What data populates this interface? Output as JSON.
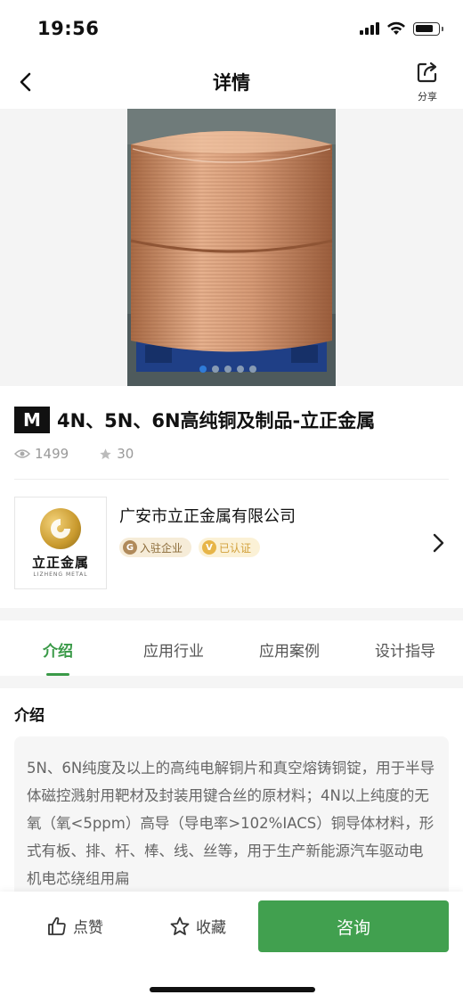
{
  "status_bar": {
    "time": "19:56"
  },
  "nav": {
    "title": "详情",
    "share_label": "分享"
  },
  "carousel": {
    "total_slides": 5,
    "active_index": 0
  },
  "product": {
    "brand_badge": "M",
    "title": "4N、5N、6N高纯铜及制品-立正金属",
    "views": "1499",
    "favorites": "30"
  },
  "company": {
    "name": "广安市立正金属有限公司",
    "logo_cn": "立正金属",
    "logo_en": "LIZHENG METAL",
    "badge_settled": "入驻企业",
    "badge_settled_icon": "G",
    "badge_verified": "已认证",
    "badge_verified_icon": "V"
  },
  "tabs": [
    {
      "label": "介绍",
      "active": true
    },
    {
      "label": "应用行业",
      "active": false
    },
    {
      "label": "应用案例",
      "active": false
    },
    {
      "label": "设计指导",
      "active": false
    }
  ],
  "intro": {
    "heading": "介绍",
    "text": "5N、6N纯度及以上的高纯电解铜片和真空熔铸铜锭，用于半导体磁控溅射用靶材及封装用键合丝的原材料；4N以上纯度的无氧（氧<5ppm）高导（导电率>102%IACS）铜导体材料，形式有板、排、杆、棒、线、丝等，用于生产新能源汽车驱动电机电芯绕组用扁"
  },
  "bottom_bar": {
    "like_label": "点赞",
    "fav_label": "收藏",
    "consult_label": "咨询"
  },
  "colors": {
    "accent": "#41a04f",
    "active_tab": "#3a9a48",
    "dot_active": "#2f7bd8"
  }
}
